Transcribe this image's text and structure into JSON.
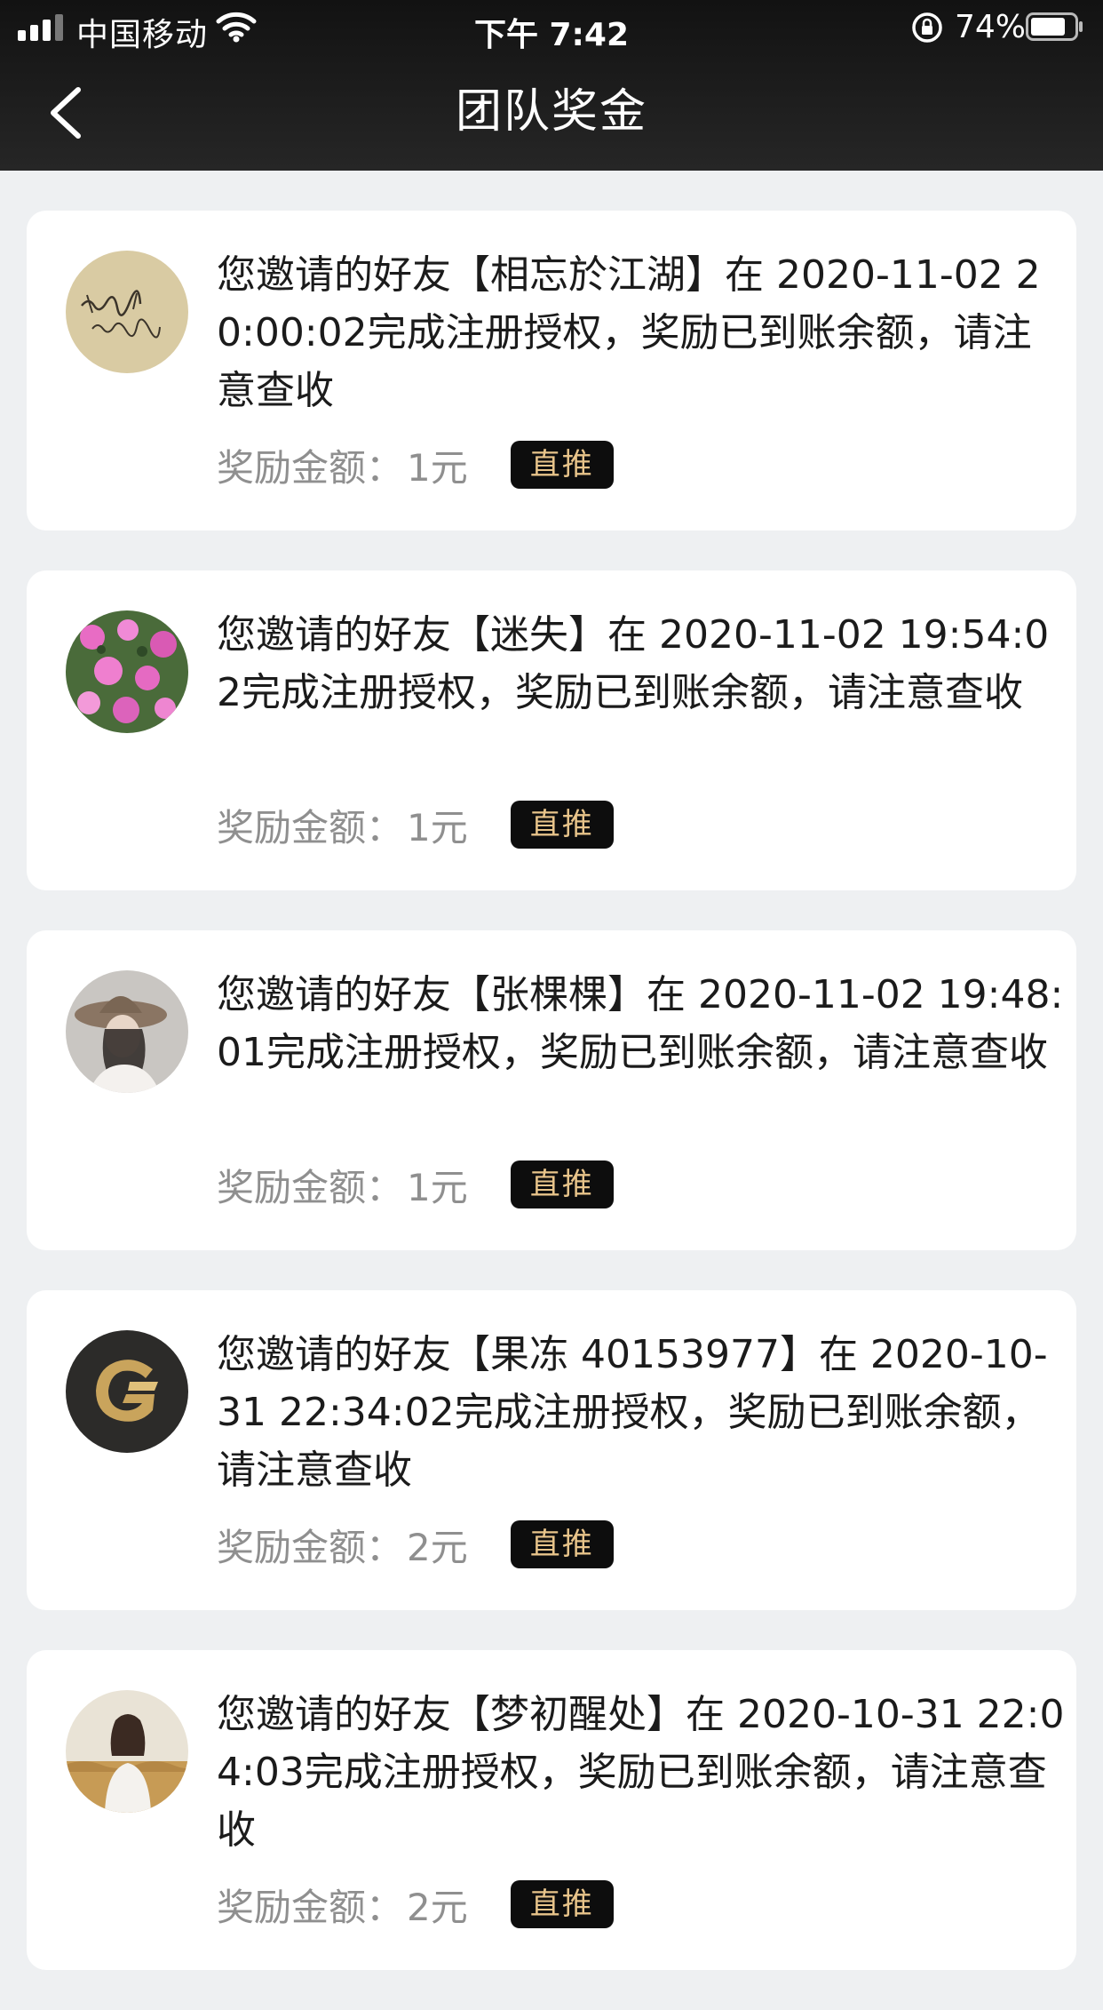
{
  "status_bar": {
    "carrier": "中国移动",
    "time": "下午 7:42",
    "battery": "74%"
  },
  "header": {
    "title": "团队奖金"
  },
  "records": [
    {
      "message": "您邀请的好友【相忘於江湖】在 2020-11-02 20:00:02完成注册授权，奖励已到账余额，请注意查收",
      "amount_label": "奖励金额：",
      "amount_value": "1元",
      "tag": "直推",
      "avatar_icon": "handwriting-avatar"
    },
    {
      "message": "您邀请的好友【迷失】在 2020-11-02 19:54:02完成注册授权，奖励已到账余额，请注意查收",
      "amount_label": "奖励金额：",
      "amount_value": "1元",
      "tag": "直推",
      "avatar_icon": "flowers-avatar"
    },
    {
      "message": "您邀请的好友【张棵棵】在 2020-11-02 19:48:01完成注册授权，奖励已到账余额，请注意查收",
      "amount_label": "奖励金额：",
      "amount_value": "1元",
      "tag": "直推",
      "avatar_icon": "hat-girl-avatar"
    },
    {
      "message": "您邀请的好友【果冻 40153977】在 2020-10-31 22:34:02完成注册授权，奖励已到账余额，请注意查收",
      "amount_label": "奖励金额：",
      "amount_value": "2元",
      "tag": "直推",
      "avatar_icon": "gold-g-logo-avatar"
    },
    {
      "message": "您邀请的好友【梦初醒处】在 2020-10-31 22:04:03完成注册授权，奖励已到账余额，请注意查收",
      "amount_label": "奖励金额：",
      "amount_value": "2元",
      "tag": "直推",
      "avatar_icon": "field-girl-avatar"
    }
  ]
}
